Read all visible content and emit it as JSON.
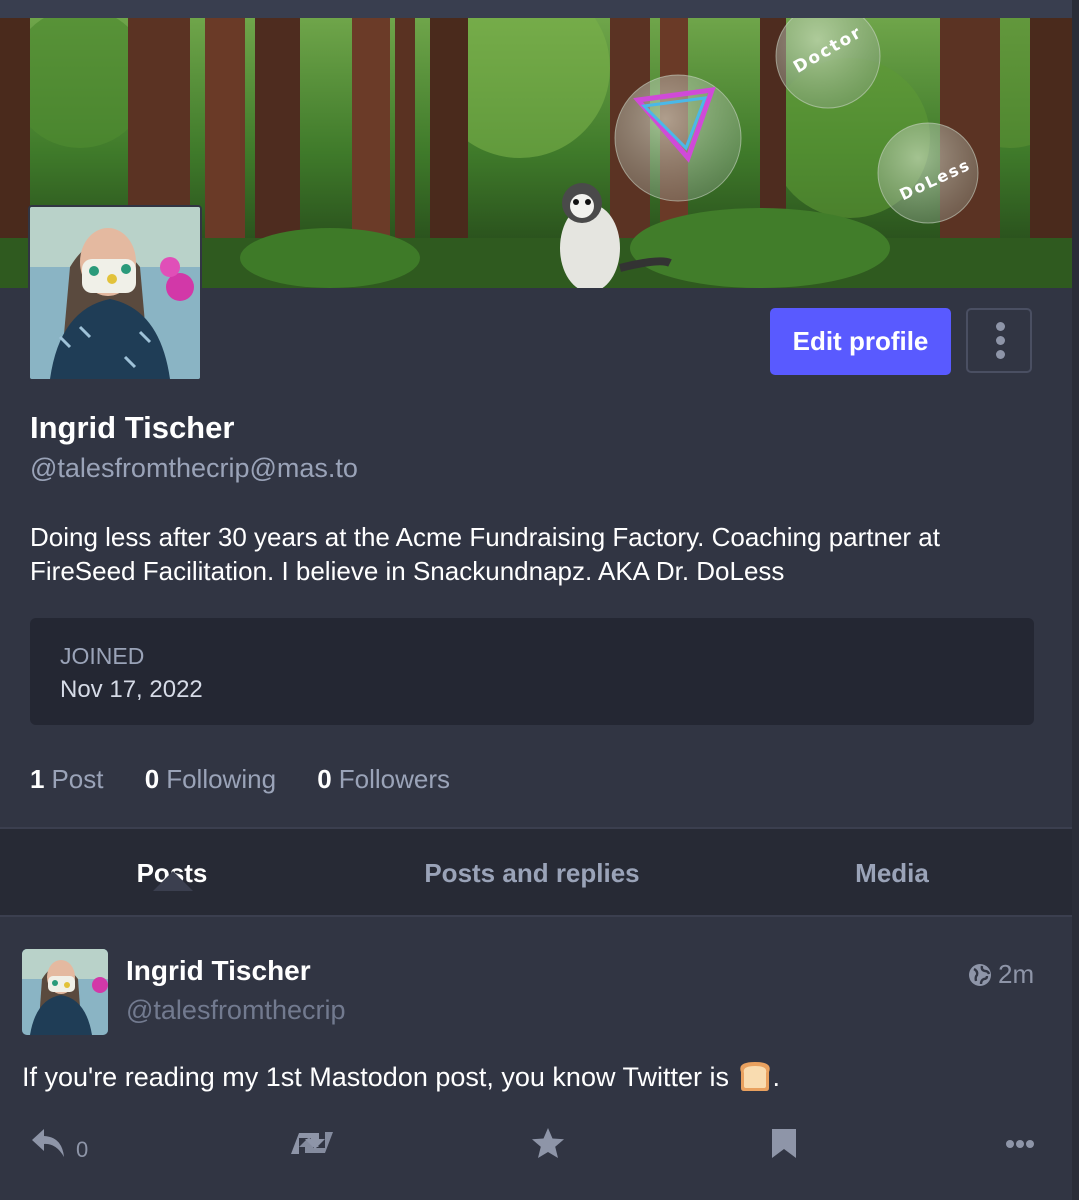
{
  "profile": {
    "display_name": "Ingrid Tischer",
    "handle": "@talesfromthecrip@mas.to",
    "bio_line1": "Doing less after 30 years at the Acme Fundraising Factory. Coaching partner at",
    "bio_line2": "FireSeed Facilitation. I believe in Snackundnapz. AKA Dr. DoLess",
    "edit_label": "Edit profile",
    "more_icon": "vertical-ellipsis-icon",
    "banner_bubbles": [
      "Doctor",
      "DoLess"
    ]
  },
  "joined": {
    "label": "Joined",
    "value": "Nov 17, 2022"
  },
  "stats": {
    "posts_count": "1",
    "posts_label": "Post",
    "following_count": "0",
    "following_label": "Following",
    "followers_count": "0",
    "followers_label": "Followers"
  },
  "tabs": [
    {
      "label": "Posts",
      "active": true
    },
    {
      "label": "Posts and replies",
      "active": false
    },
    {
      "label": "Media",
      "active": false
    }
  ],
  "post": {
    "author": "Ingrid Tischer",
    "handle": "@talesfromthecrip",
    "time": "2m",
    "text_before": "If you're reading my 1st Mastodon post, you know Twitter is ",
    "text_after": ".",
    "emoji": "bread",
    "reply_count": "0",
    "visibility_icon": "globe-icon"
  },
  "colors": {
    "accent": "#595aff",
    "background": "#313543",
    "muted_text": "#9aa3b8"
  }
}
